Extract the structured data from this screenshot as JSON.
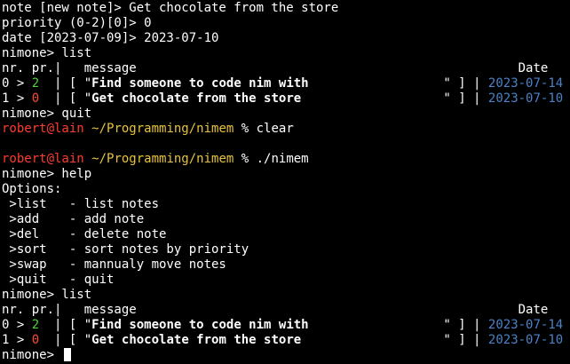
{
  "palette": {
    "background": "#000000",
    "text": "#ffffff",
    "priority_green": "#4fd13a",
    "priority_red": "#ff4a3d",
    "prompt_user": "#ff3b2f",
    "prompt_path": "#e8c33a",
    "date": "#4b82c7"
  },
  "lines": [
    [
      {
        "t": "note [new note]> Get chocolate from the store"
      }
    ],
    [
      {
        "t": "priority (0-2)[0]> 0"
      }
    ],
    [
      {
        "t": "date [2023-07-09]> 2023-07-10"
      }
    ],
    [
      {
        "t": "nimone> list"
      }
    ],
    [
      {
        "t": "nr. pr.|   message                                                   Date"
      }
    ],
    [
      {
        "t": "0 > "
      },
      {
        "t": "2",
        "c": "green"
      },
      {
        "t": "  | [ \""
      },
      {
        "t": "Find someone to code nim with",
        "c": "bold"
      },
      {
        "t": "                  \" ] | "
      },
      {
        "t": "2023-07-14",
        "c": "date"
      }
    ],
    [
      {
        "t": "1 > "
      },
      {
        "t": "0",
        "c": "red"
      },
      {
        "t": "  | [ \""
      },
      {
        "t": "Get chocolate from the store",
        "c": "bold"
      },
      {
        "t": "                   \" ] | "
      },
      {
        "t": "2023-07-10",
        "c": "date"
      }
    ],
    [
      {
        "t": "nimone> quit"
      }
    ],
    [
      {
        "t": "robert@lain",
        "c": "user"
      },
      {
        "t": " "
      },
      {
        "t": "~/Programming/nimem",
        "c": "path"
      },
      {
        "t": " % clear"
      }
    ],
    [
      {
        "t": ""
      }
    ],
    [
      {
        "t": "robert@lain",
        "c": "user"
      },
      {
        "t": " "
      },
      {
        "t": "~/Programming/nimem",
        "c": "path"
      },
      {
        "t": " % ./nimem"
      }
    ],
    [
      {
        "t": "nimone> help"
      }
    ],
    [
      {
        "t": "Options:"
      }
    ],
    [
      {
        "t": " >list   - list notes"
      }
    ],
    [
      {
        "t": " >add    - add note"
      }
    ],
    [
      {
        "t": " >del    - delete note"
      }
    ],
    [
      {
        "t": " >sort   - sort notes by priority"
      }
    ],
    [
      {
        "t": " >swap   - mannualy move notes"
      }
    ],
    [
      {
        "t": " >quit   - quit"
      }
    ],
    [
      {
        "t": "nimone> list"
      }
    ],
    [
      {
        "t": "nr. pr.|   message                                                   Date"
      }
    ],
    [
      {
        "t": "0 > "
      },
      {
        "t": "2",
        "c": "green"
      },
      {
        "t": "  | [ \""
      },
      {
        "t": "Find someone to code nim with",
        "c": "bold"
      },
      {
        "t": "                  \" ] | "
      },
      {
        "t": "2023-07-14",
        "c": "date"
      }
    ],
    [
      {
        "t": "1 > "
      },
      {
        "t": "0",
        "c": "red"
      },
      {
        "t": "  | [ \""
      },
      {
        "t": "Get chocolate from the store",
        "c": "bold"
      },
      {
        "t": "                   \" ] | "
      },
      {
        "t": "2023-07-10",
        "c": "date"
      }
    ],
    [
      {
        "t": "nimone> "
      }
    ]
  ],
  "cursor": "block-cursor"
}
